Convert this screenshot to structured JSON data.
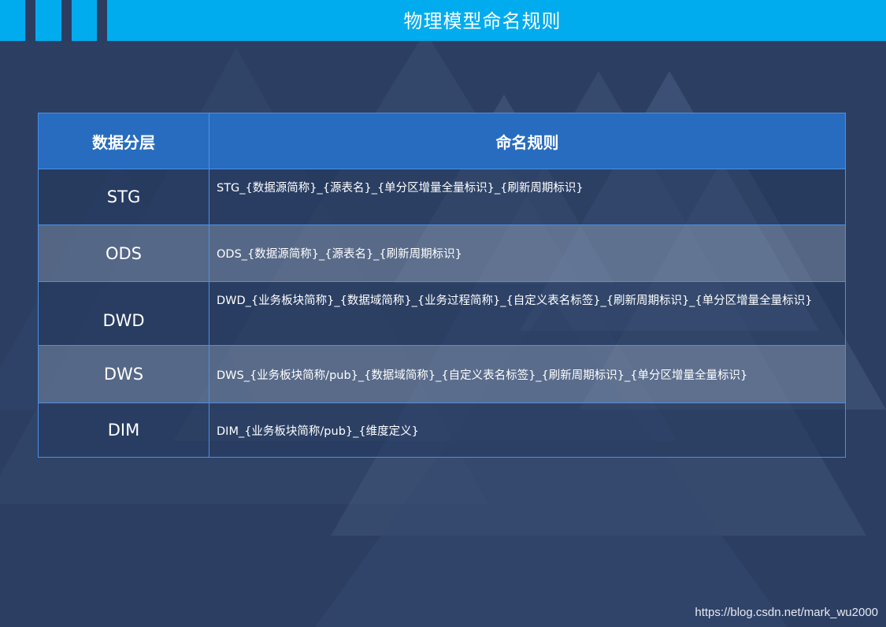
{
  "header": {
    "title": "物理模型命名规则"
  },
  "table": {
    "headers": [
      "数据分层",
      "命名规则"
    ],
    "rows": [
      {
        "layer": "STG",
        "rule": "STG_{数据源简称}_{源表名}_{单分区增量全量标识}_{刷新周期标识}"
      },
      {
        "layer": "ODS",
        "rule": "ODS_{数据源简称}_{源表名}_{刷新周期标识}"
      },
      {
        "layer": "DWD",
        "rule": "DWD_{业务板块简称}_{数据域简称}_{业务过程简称}_{自定义表名标签}_{刷新周期标识}_{单分区增量全量标识}"
      },
      {
        "layer": "DWS",
        "rule": "DWS_{业务板块简称/pub}_{数据域简称}_{自定义表名标签}_{刷新周期标识}_{单分区增量全量标识}"
      },
      {
        "layer": "DIM",
        "rule": "DIM_{业务板块简称/pub}_{维度定义}"
      }
    ]
  },
  "watermark": "https://blog.csdn.net/mark_wu2000",
  "colors": {
    "header_bar": "#00acee",
    "background": "#2c3f63",
    "table_header": "#286cc0",
    "table_border": "#4d8fe4"
  }
}
